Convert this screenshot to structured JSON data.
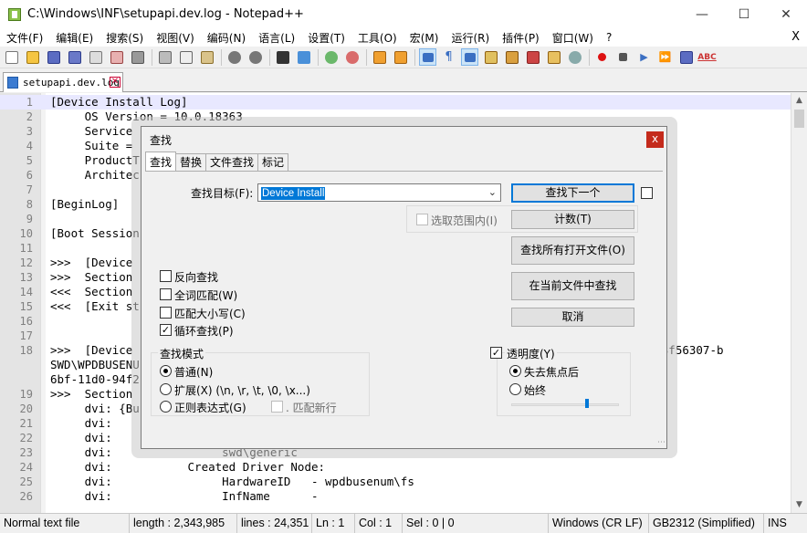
{
  "window": {
    "title": "C:\\Windows\\INF\\setupapi.dev.log - Notepad++"
  },
  "menu": [
    "文件(F)",
    "编辑(E)",
    "搜索(S)",
    "视图(V)",
    "编码(N)",
    "语言(L)",
    "设置(T)",
    "工具(O)",
    "宏(M)",
    "运行(R)",
    "插件(P)",
    "窗口(W)",
    "?"
  ],
  "menu_close": "X",
  "tab": {
    "label": "setupapi.dev.log"
  },
  "lines": [
    {
      "n": "1",
      "t": "[Device Install Log]",
      "cur": true
    },
    {
      "n": "2",
      "t": "     OS Version = 10.0.18363"
    },
    {
      "n": "3",
      "t": "     Service"
    },
    {
      "n": "4",
      "t": "     Suite ="
    },
    {
      "n": "5",
      "t": "     ProductT"
    },
    {
      "n": "6",
      "t": "     Architec"
    },
    {
      "n": "7",
      "t": ""
    },
    {
      "n": "8",
      "t": "[BeginLog]"
    },
    {
      "n": "9",
      "t": ""
    },
    {
      "n": "10",
      "t": "[Boot Session"
    },
    {
      "n": "11",
      "t": ""
    },
    {
      "n": "12",
      "t": ">>>  [Device"
    },
    {
      "n": "13",
      "t": ">>>  Section"
    },
    {
      "n": "14",
      "t": "<<<  Section"
    },
    {
      "n": "15",
      "t": "<<<  [Exit st"
    },
    {
      "n": "16",
      "t": ""
    },
    {
      "n": "17",
      "t": ""
    },
    {
      "n": "18",
      "t": ">>>  [Device                                                                      85&0#{53f56307-b"
    },
    {
      "n": "",
      "t": "SWD\\WPDBUSENU"
    },
    {
      "n": "",
      "t": "6bf-11d0-94f2"
    },
    {
      "n": "19",
      "t": ">>>  Section"
    },
    {
      "n": "20",
      "t": "     dvi: {Bu"
    },
    {
      "n": "21",
      "t": "     dvi:"
    },
    {
      "n": "22",
      "t": "     dvi:"
    },
    {
      "n": "23",
      "t": "     dvi:                swd\\generic"
    },
    {
      "n": "24",
      "t": "     dvi:           Created Driver Node:"
    },
    {
      "n": "25",
      "t": "     dvi:                HardwareID   - wpdbusenum\\fs"
    },
    {
      "n": "26",
      "t": "     dvi:                InfName      -"
    }
  ],
  "status": {
    "type": "Normal text file",
    "length": "length : 2,343,985",
    "lines": "lines : 24,351",
    "ln": "Ln : 1",
    "col": "Col : 1",
    "sel": "Sel : 0 | 0",
    "eol": "Windows (CR LF)",
    "encoding": "GB2312 (Simplified)",
    "mode": "INS"
  },
  "dialog": {
    "title": "查找",
    "close": "x",
    "tabs": [
      "查找",
      "替换",
      "文件查找",
      "标记"
    ],
    "find_label": "查找目标(F):",
    "find_value": "Device Install",
    "in_selection": "选取范围内(I)",
    "buttons": {
      "find_next": "查找下一个",
      "count": "计数(T)",
      "find_all_open": "查找所有打开文件(O)",
      "find_current": "在当前文件中查找",
      "cancel": "取消"
    },
    "options": {
      "backward": "反向查找",
      "whole_word": "全词匹配(W)",
      "match_case": "匹配大小写(C)",
      "wrap": "循环查找(P)",
      "wrap_check": "✓"
    },
    "search_mode": {
      "title": "查找模式",
      "normal": "普通(N)",
      "extended": "扩展(X) (\\n, \\r, \\t, \\0, \\x...)",
      "regex": "正则表达式(G)",
      "dot_newline": ". 匹配新行"
    },
    "transparency": {
      "title": "透明度(Y)",
      "check": "✓",
      "on_lose_focus": "失去焦点后",
      "always": "始终",
      "level": 0.7
    }
  }
}
